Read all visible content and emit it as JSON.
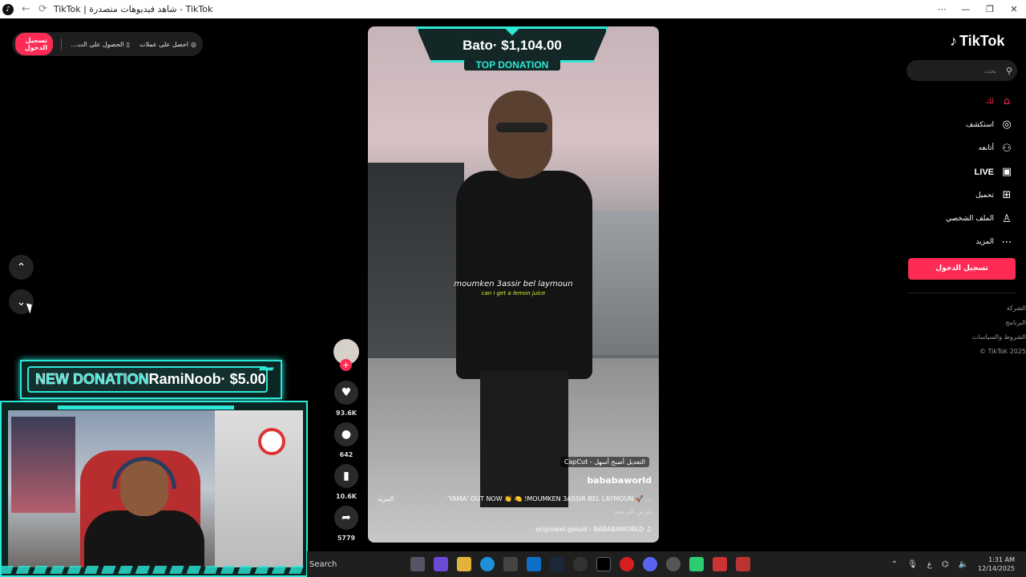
{
  "browser": {
    "title": "TikTok | شاهد فيديوهات متصدرة - TikTok",
    "controls": [
      "⋯",
      "—",
      "❐",
      "✕"
    ]
  },
  "topbar": {
    "coins_label": "احصل على عملات",
    "app_label": "الحصول على الت...",
    "login_label": "تسجيل الدخول"
  },
  "overlay": {
    "new_donation_label": "NEW DONATION",
    "new_donation_text": "RamiNoob· $5.00",
    "top_donation_amount": "Bato· $1,104.00",
    "top_donation_label": "TOP DONATION"
  },
  "video": {
    "caption_main": "moumken 3assir bel laymoun",
    "caption_sub": "can i get a lemon juice",
    "capcut_label": "CapCut - التعديل أصبح أسهل",
    "author": "bababaworld",
    "description": "'YAMA' OUT NOW 👏 🍋 !MOUMKEN 3ASSIR BEL LAYMOUN 🚀 ...",
    "more_label": "المزيد",
    "translate_label": "عرض الترجمة",
    "music": "originieel geluid - BABABAWORLD"
  },
  "actions": {
    "likes": "93.6K",
    "comments": "642",
    "saves": "10.6K",
    "shares": "5779"
  },
  "sidebar": {
    "logo": "TikTok",
    "search_placeholder": "بحث",
    "items": [
      {
        "label": "لك",
        "icon": "home-icon"
      },
      {
        "label": "استكشف",
        "icon": "compass-icon"
      },
      {
        "label": "أتابعه",
        "icon": "user-follow-icon"
      },
      {
        "label": "LIVE",
        "icon": "live-icon"
      },
      {
        "label": "تحميل",
        "icon": "upload-icon"
      },
      {
        "label": "الملف الشخصي",
        "icon": "profile-icon"
      },
      {
        "label": "المزيد",
        "icon": "more-icon"
      }
    ],
    "login_label": "تسجيل الدخول",
    "footer": [
      "الشركة",
      "البرنامج",
      "الشروط والسياسات",
      "© TikTok 2025"
    ]
  },
  "taskbar": {
    "search_label": "Search",
    "time": "1:31 AM",
    "date": "12/14/2025",
    "lang": "ع"
  },
  "colors": {
    "accent": "#fe2c55",
    "overlay_teal": "#2ee6d6"
  }
}
